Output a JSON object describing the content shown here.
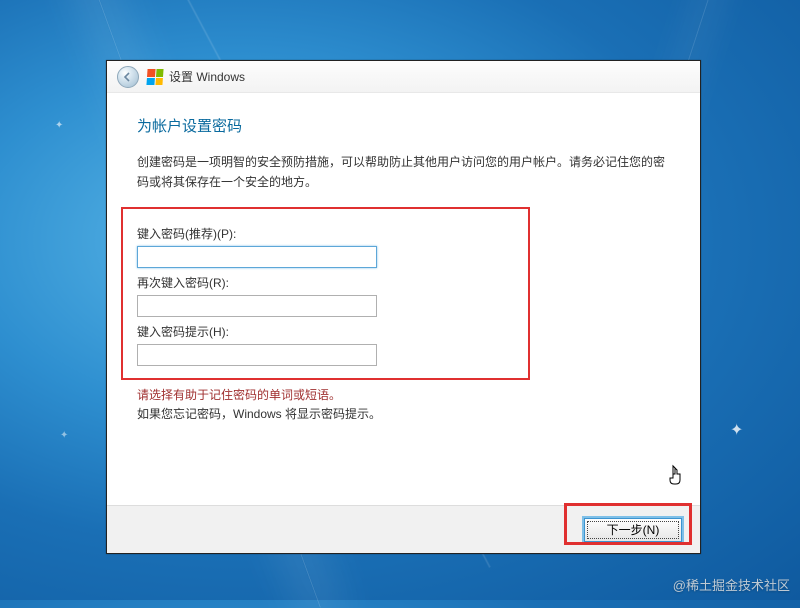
{
  "header": {
    "title": "设置 Windows"
  },
  "main": {
    "title": "为帐户设置密码",
    "description": "创建密码是一项明智的安全预防措施，可以帮助防止其他用户访问您的用户帐户。请务必记住您的密码或将其保存在一个安全的地方。",
    "password_label": "键入密码(推荐)(P):",
    "password_value": "",
    "confirm_label": "再次键入密码(R):",
    "confirm_value": "",
    "hint_label": "键入密码提示(H):",
    "hint_value": "",
    "hint_help1": "请选择有助于记住密码的单词或短语。",
    "hint_help2": "如果您忘记密码，Windows 将显示密码提示。"
  },
  "footer": {
    "next_label": "下一步(N)"
  },
  "watermark": "@稀土掘金技术社区"
}
